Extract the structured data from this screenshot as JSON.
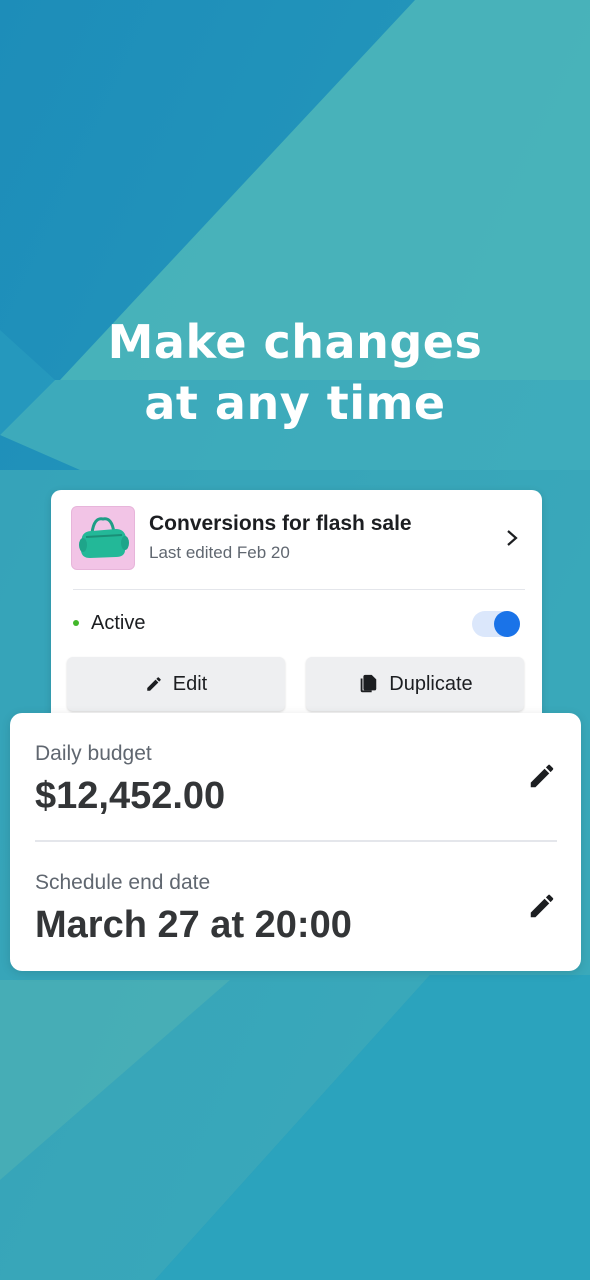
{
  "headline": {
    "line1": "Make changes",
    "line2": "at any time"
  },
  "campaign": {
    "title": "Conversions for flash sale",
    "subtitle": "Last edited Feb 20",
    "status": "Active",
    "toggle_on": true,
    "edit_label": "Edit",
    "duplicate_label": "Duplicate",
    "thumbnail": "green-duffel-bag"
  },
  "settings": {
    "budget_label": "Daily budget",
    "budget_value": "$12,452.00",
    "schedule_label": "Schedule end date",
    "schedule_value": "March 27 at 20:00"
  },
  "colors": {
    "accent": "#1a73e8",
    "status_active": "#42b72a",
    "background_start": "#1f93bc",
    "background_end": "#5abfb6"
  },
  "icons": {
    "chevron": "chevron-right-icon",
    "edit": "pencil-icon",
    "duplicate": "copy-icon",
    "row_edit": "pencil-icon"
  }
}
